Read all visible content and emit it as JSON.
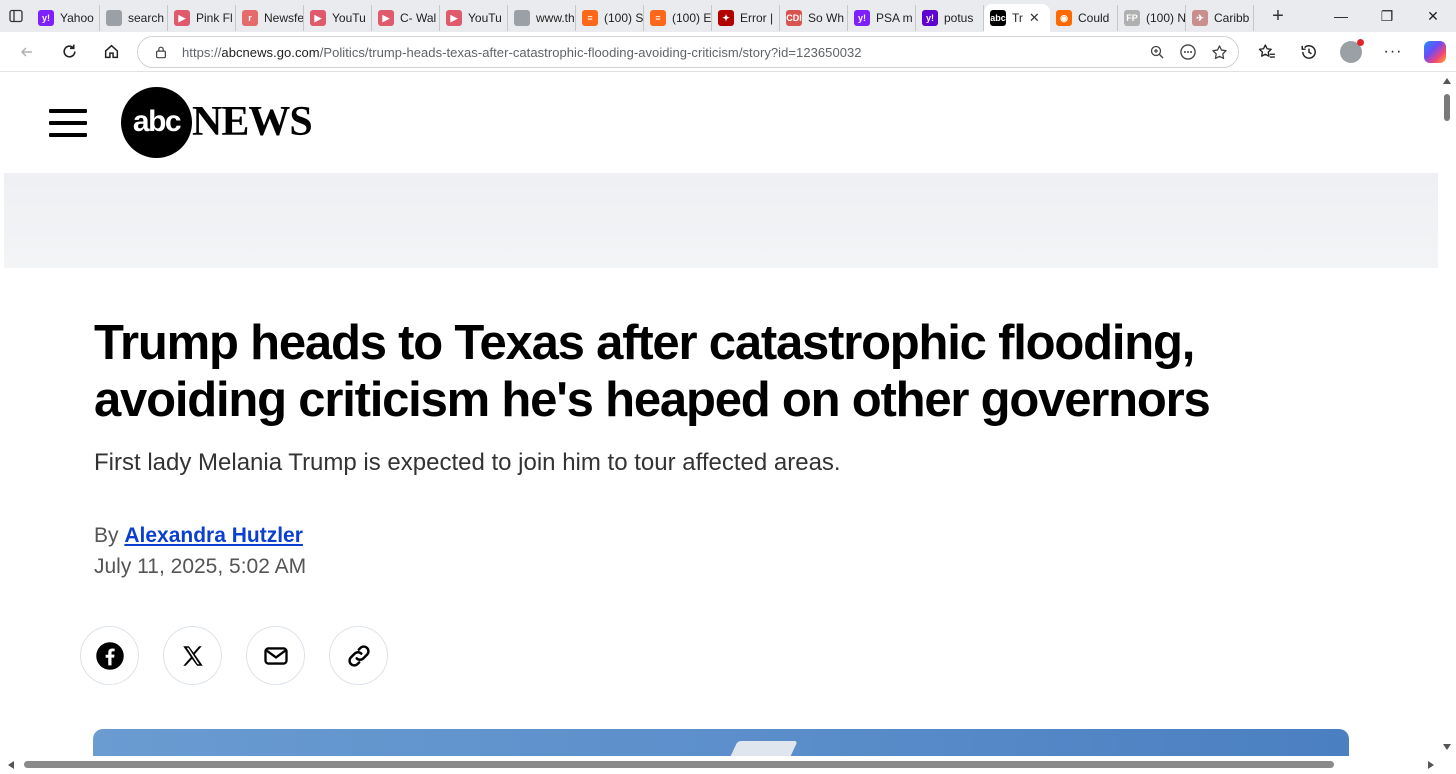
{
  "browser": {
    "tabs": [
      {
        "label": "Yahoo",
        "fav_text": "y!",
        "fav_color": "#7e1fff"
      },
      {
        "label": "search",
        "fav_text": "",
        "fav_color": "#9aa0a6"
      },
      {
        "label": "Pink Fl",
        "fav_text": "▶",
        "fav_color": "#e05a6d"
      },
      {
        "label": "Newsfe",
        "fav_text": "r",
        "fav_color": "#e56b6b"
      },
      {
        "label": "YouTu",
        "fav_text": "▶",
        "fav_color": "#e05a6d"
      },
      {
        "label": "C- Wal",
        "fav_text": "▶",
        "fav_color": "#e05a6d"
      },
      {
        "label": "YouTu",
        "fav_text": "▶",
        "fav_color": "#e05a6d"
      },
      {
        "label": "www.th",
        "fav_text": "",
        "fav_color": "#9aa0a6"
      },
      {
        "label": "(100) S",
        "fav_text": "≡",
        "fav_color": "#ff6719"
      },
      {
        "label": "(100) E",
        "fav_text": "≡",
        "fav_color": "#ff6719"
      },
      {
        "label": "Error |",
        "fav_text": "✦",
        "fav_color": "#b00000"
      },
      {
        "label": "So Wh",
        "fav_text": "CDI",
        "fav_color": "#d9534f"
      },
      {
        "label": "PSA m",
        "fav_text": "y!",
        "fav_color": "#7e1fff"
      },
      {
        "label": "potus",
        "fav_text": "y!",
        "fav_color": "#5f01d1"
      },
      {
        "label": "Tr",
        "fav_text": "abc",
        "fav_color": "#000000",
        "active": true
      },
      {
        "label": "Could",
        "fav_text": "◉",
        "fav_color": "#ff6a00"
      },
      {
        "label": "(100) N",
        "fav_text": "FP",
        "fav_color": "#b0b0b0"
      },
      {
        "label": "Caribb",
        "fav_text": "✈",
        "fav_color": "#c98f8f"
      }
    ],
    "url_scheme": "https://",
    "url_host": "abcnews.go.com",
    "url_path": "/Politics/trump-heads-texas-after-catastrophic-flooding-avoiding-criticism/story?id=123650032"
  },
  "site": {
    "logo_mark": "abc",
    "logo_word": "NEWS"
  },
  "article": {
    "headline": "Trump heads to Texas after catastrophic flooding, avoiding criticism he's heaped on other governors",
    "subhead": "First lady Melania Trump is expected to join him to tour affected areas.",
    "byline_prefix": "By",
    "author": "Alexandra Hutzler",
    "date": "July 11, 2025, 5:02 AM"
  },
  "share": {
    "icons": [
      "facebook-icon",
      "x-icon",
      "mail-icon",
      "link-icon"
    ]
  },
  "colors": {
    "author_link": "#0a3fd1",
    "tab_strip": "#e9ebee"
  }
}
